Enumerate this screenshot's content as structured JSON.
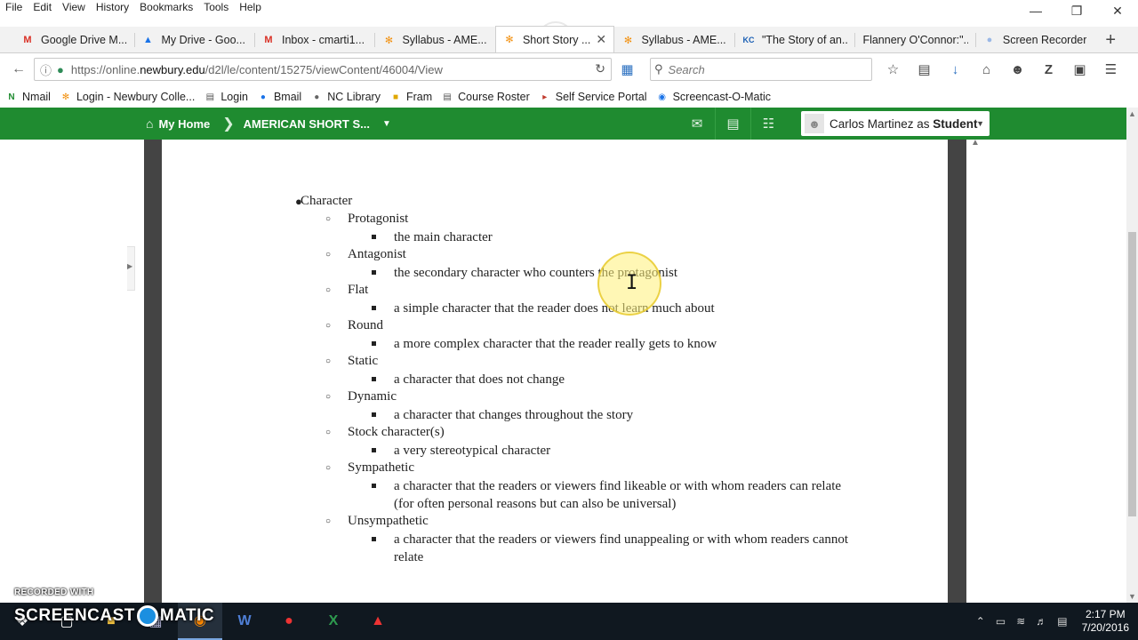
{
  "menu": [
    "File",
    "Edit",
    "View",
    "History",
    "Bookmarks",
    "Tools",
    "Help"
  ],
  "window_controls": [
    "minimize-icon",
    "restore-icon",
    "close-icon"
  ],
  "tabs": [
    {
      "label": "Google Drive M...",
      "icon": "gmail-icon",
      "color": "#d93025"
    },
    {
      "label": "My Drive - Goo...",
      "icon": "drive-icon",
      "color": "#1a73e8"
    },
    {
      "label": "Inbox - cmarti1...",
      "icon": "gmail-icon",
      "color": "#d93025"
    },
    {
      "label": "Syllabus - AME...",
      "icon": "d2l-icon",
      "color": "#f29111"
    },
    {
      "label": "Short Story ...",
      "icon": "d2l-icon",
      "color": "#f29111",
      "active": true
    },
    {
      "label": "Syllabus - AME...",
      "icon": "d2l-icon",
      "color": "#f29111"
    },
    {
      "label": "\"The Story of an...",
      "icon": "kc-icon",
      "color": "#1a5fb4"
    },
    {
      "label": "Flannery O'Connor:\"...",
      "icon": "",
      "color": ""
    },
    {
      "label": "Screen Recorder",
      "icon": "recorder-icon",
      "color": "#9ab8e6"
    }
  ],
  "nav": {
    "url_prefix": "https://online.",
    "url_domain": "newbury.edu",
    "url_path": "/d2l/le/content/15275/viewContent/46004/View",
    "search_placeholder": "Search"
  },
  "bookmarks": [
    {
      "label": "Nmail",
      "icon": "nmail-icon",
      "color": "#1f8b30"
    },
    {
      "label": "Login - Newbury Colle...",
      "icon": "d2l-icon",
      "color": "#f29111"
    },
    {
      "label": "Login",
      "icon": "page-icon",
      "color": "#555555"
    },
    {
      "label": "Bmail",
      "icon": "globe-icon",
      "color": "#1a73e8"
    },
    {
      "label": "NC Library",
      "icon": "globe-icon",
      "color": "#666666"
    },
    {
      "label": "Fram",
      "icon": "page-icon",
      "color": "#e0a800"
    },
    {
      "label": "Course Roster",
      "icon": "page-icon",
      "color": "#555555"
    },
    {
      "label": "Self Service Portal",
      "icon": "portal-icon",
      "color": "#c0392b"
    },
    {
      "label": "Screencast-O-Matic",
      "icon": "record-icon",
      "color": "#1a73e8"
    }
  ],
  "d2l": {
    "home_label": "My Home",
    "course_label": "AMERICAN SHORT S...",
    "user_name": "Carlos Martinez as ",
    "user_role": "Student"
  },
  "document": {
    "heading": "Character",
    "items": [
      {
        "term": "Protagonist",
        "def": "the main character"
      },
      {
        "term": "Antagonist",
        "def": "the secondary character who counters the protagonist"
      },
      {
        "term": "Flat",
        "def": "a simple character that the reader does not learn much about"
      },
      {
        "term": "Round",
        "def": "a more complex character that the reader really gets to know"
      },
      {
        "term": "Static",
        "def": "a character that does not change"
      },
      {
        "term": "Dynamic",
        "def": "a character that changes throughout the story"
      },
      {
        "term": "Stock character(s)",
        "def": "a very stereotypical character"
      },
      {
        "term": "Sympathetic",
        "def": "a character that the readers or viewers find likeable or with whom readers can relate (for often personal reasons but can also be universal)"
      },
      {
        "term": "Unsympathetic",
        "def": "a character that the readers or viewers find unappealing or with whom readers cannot relate"
      }
    ]
  },
  "watermark": {
    "recorded_with": "RECORDED WITH",
    "logo_left": "SCREENCAST",
    "logo_right": "MATIC"
  },
  "taskbar": {
    "apps": [
      "windows-icon",
      "firefox-icon",
      "word-icon",
      "record-icon",
      "excel-icon",
      "acrobat-icon"
    ],
    "time": "2:17 PM",
    "date": "7/20/2016"
  }
}
